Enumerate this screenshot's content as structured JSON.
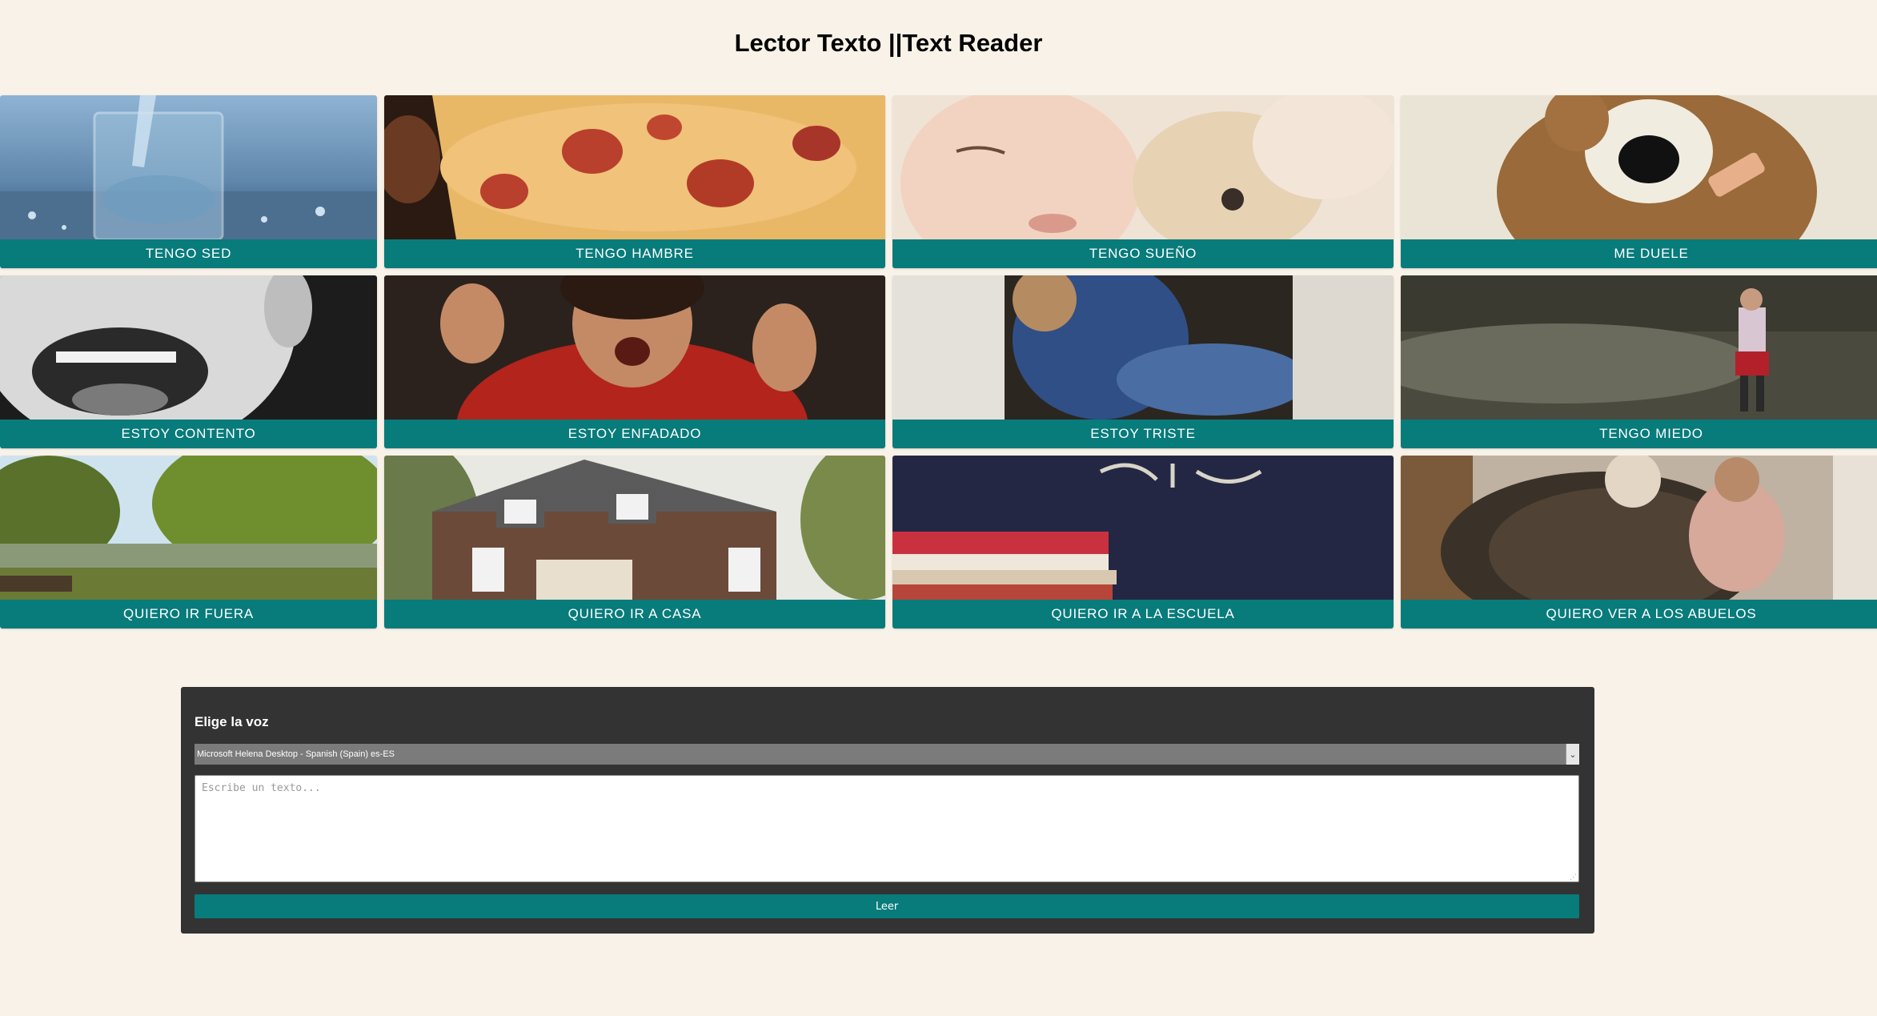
{
  "header": {
    "title": "Lector Texto ||Text Reader"
  },
  "cards": [
    {
      "label": "TENGO SED",
      "icon": "water-glass-image"
    },
    {
      "label": "TENGO HAMBRE",
      "icon": "pizza-image"
    },
    {
      "label": "TENGO SUEÑO",
      "icon": "sleeping-child-image"
    },
    {
      "label": "ME DUELE",
      "icon": "teddy-bear-bandage-image"
    },
    {
      "label": "ESTOY CONTENTO",
      "icon": "laughing-mouth-image"
    },
    {
      "label": "ESTOY ENFADADO",
      "icon": "angry-child-image"
    },
    {
      "label": "ESTOY TRISTE",
      "icon": "sad-child-image"
    },
    {
      "label": "TENGO MIEDO",
      "icon": "scared-child-image"
    },
    {
      "label": "QUIERO IR FUERA",
      "icon": "park-image"
    },
    {
      "label": "QUIERO IR A CASA",
      "icon": "house-image"
    },
    {
      "label": "QUIERO IR A LA ESCUELA",
      "icon": "books-chalkboard-image"
    },
    {
      "label": "QUIERO VER A LOS ABUELOS",
      "icon": "grandparents-image"
    }
  ],
  "panel": {
    "title": "Elige la voz",
    "voice_selected": "Microsoft Helena Desktop - Spanish (Spain) es-ES",
    "text_placeholder": "Escribe un texto...",
    "text_value": "",
    "read_button": "Leer"
  },
  "colors": {
    "background": "#f9f2e8",
    "accent": "#087b7b",
    "panel": "#333333"
  }
}
